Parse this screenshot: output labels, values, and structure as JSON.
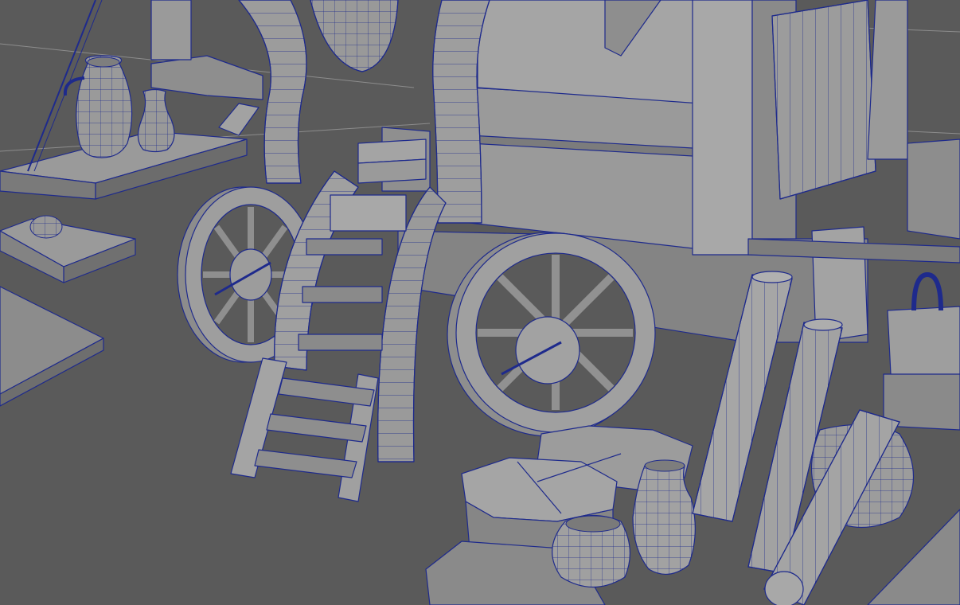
{
  "viewport": {
    "colors": {
      "background": "#5a5a5a",
      "shade_light": "#9a9a9a",
      "shade_mid": "#8a8a8a",
      "shade_dark": "#747474",
      "wire": "#1e2a8c",
      "grid": "#8d8d8d"
    },
    "props": [
      {
        "name": "wooden-wagon",
        "icon": "wagon-icon"
      },
      {
        "name": "wagon-wheel-left",
        "icon": "wheel-icon"
      },
      {
        "name": "wagon-wheel-right",
        "icon": "wheel-icon"
      },
      {
        "name": "wooden-ladder",
        "icon": "ladder-icon"
      },
      {
        "name": "log-1",
        "icon": "log-icon"
      },
      {
        "name": "log-2",
        "icon": "log-icon"
      },
      {
        "name": "log-3",
        "icon": "log-icon"
      },
      {
        "name": "pottery-jug",
        "icon": "jug-icon"
      },
      {
        "name": "pottery-pot",
        "icon": "pot-icon"
      },
      {
        "name": "octagonal-crates",
        "icon": "crate-icon"
      },
      {
        "name": "left-platform-table",
        "icon": "table-icon"
      }
    ]
  }
}
